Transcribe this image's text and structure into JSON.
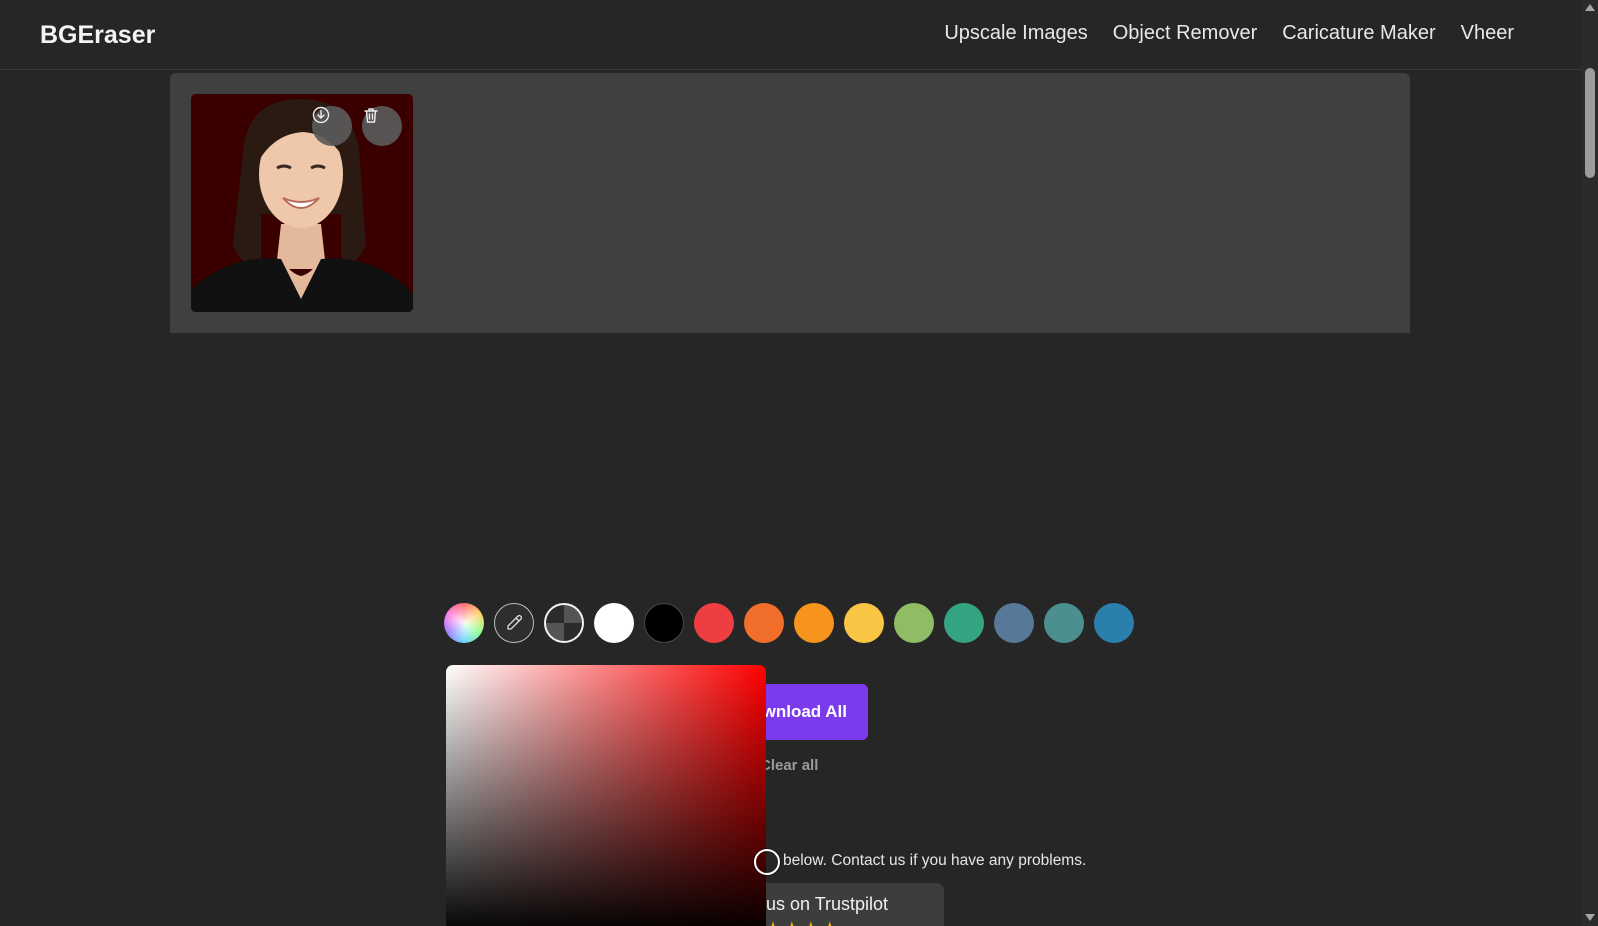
{
  "header": {
    "logo": "BGEraser",
    "nav": [
      {
        "label": "Upscale Images",
        "name": "nav-upscale-images"
      },
      {
        "label": "Object Remover",
        "name": "nav-object-remover"
      },
      {
        "label": "Caricature Maker",
        "name": "nav-caricature-maker"
      },
      {
        "label": "Vheer",
        "name": "nav-vheer"
      }
    ]
  },
  "thumbnail": {
    "download_icon": "download-icon",
    "delete_icon": "trash-icon"
  },
  "swatches": [
    {
      "name": "rainbow-swatch",
      "type": "rainbow"
    },
    {
      "name": "eyedropper-swatch",
      "type": "picker",
      "icon": "eyedropper-icon"
    },
    {
      "name": "transparent-swatch",
      "type": "trans"
    },
    {
      "name": "white-swatch",
      "color": "#ffffff"
    },
    {
      "name": "black-swatch",
      "color": "#000000"
    },
    {
      "name": "red-swatch",
      "color": "#ef3e42"
    },
    {
      "name": "orange-swatch",
      "color": "#f26f2b"
    },
    {
      "name": "amber-swatch",
      "color": "#f7941d"
    },
    {
      "name": "yellow-swatch",
      "color": "#f8c544"
    },
    {
      "name": "green-swatch",
      "color": "#8fbc65"
    },
    {
      "name": "teal-swatch",
      "color": "#35a482"
    },
    {
      "name": "slate-swatch",
      "color": "#58789a"
    },
    {
      "name": "cyan-swatch",
      "color": "#4b8f8f"
    },
    {
      "name": "blue-swatch",
      "color": "#2a7fac"
    }
  ],
  "actions": {
    "download_all": "wnload All",
    "clear_all": "Clear all"
  },
  "contact_text": "below. Contact us if you have any problems.",
  "trustpilot": {
    "label": "us on Trustpilot",
    "stars": "★★★★"
  },
  "colors": {
    "accent": "#7c3aed",
    "background": "#262626",
    "panel": "#404040",
    "thumb_bg": "#3a0000",
    "picker_hue": "#ff0000"
  }
}
